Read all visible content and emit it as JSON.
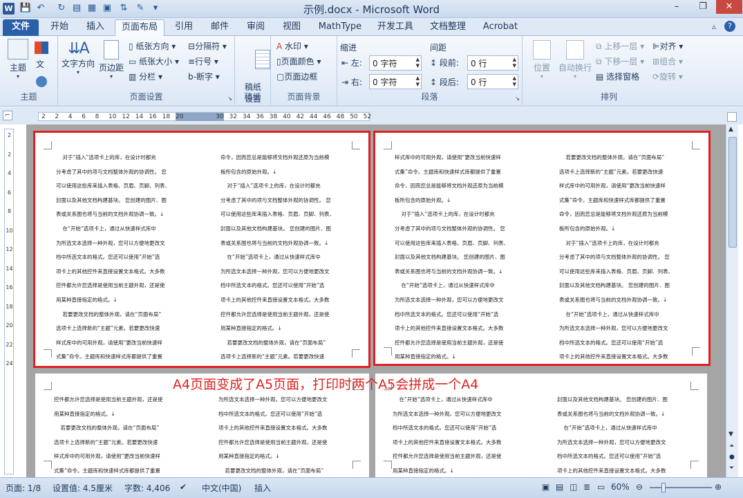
{
  "window": {
    "title": "示例.docx - Microsoft Word",
    "minimize": "–",
    "restore": "❐",
    "close": "✕"
  },
  "tabs": [
    "文件",
    "开始",
    "插入",
    "页面布局",
    "引用",
    "邮件",
    "审阅",
    "视图",
    "MathType",
    "开发工具",
    "文档整理",
    "Acrobat"
  ],
  "ribbon": {
    "theme": {
      "btn": "主题",
      "label": "主题"
    },
    "page_setup": {
      "text_dir": "文字方向",
      "margins": "页边距",
      "paper_dir": "纸张方向",
      "paper_size": "纸张大小",
      "columns": "分栏",
      "breaks": "分隔符",
      "line_num": "行号",
      "hyphen": "断字",
      "label": "页面设置"
    },
    "draft": {
      "btn": "稿纸\n设置",
      "label": "稿纸"
    },
    "background": {
      "watermark": "水印",
      "page_color": "页面颜色",
      "page_border": "页面边框",
      "label": "页面背景"
    },
    "paragraph": {
      "indent": "缩进",
      "left": "左:",
      "left_val": "0 字符",
      "right": "右:",
      "right_val": "0 字符",
      "spacing": "间距",
      "before": "段前:",
      "before_val": "0 行",
      "after": "段后:",
      "after_val": "0 行",
      "label": "段落"
    },
    "arrange": {
      "position": "位置",
      "wrap": "自动换行",
      "forward": "上移一层",
      "backward": "下移一层",
      "select": "选择窗格",
      "align": "对齐",
      "group": "组合",
      "rotate": "旋转",
      "label": "排列"
    }
  },
  "ruler": {
    "h": [
      "2",
      "2",
      "4",
      "6",
      "8",
      "10",
      "12",
      "14",
      "16",
      "18",
      "20",
      "",
      "",
      "30",
      "32",
      "34",
      "36",
      "38",
      "40",
      "42",
      "44",
      "46",
      "48",
      "50",
      "52"
    ],
    "v": [
      "2",
      "2",
      "4",
      "6",
      "8",
      "10",
      "12",
      "14",
      "16",
      "18",
      "20",
      "22",
      "24"
    ]
  },
  "caption": "A4页面变成了A5页面，打印时两个A5会拼成一个A4",
  "pages": {
    "p1_left": [
      "    对于“插入”选项卡上的库，在设计时都充",
      "分考虑了其中的项与文档整体外观的协调性。 您",
      "可以使用这些库来插入表格、页眉、页脚、列表、",
      "封面以及其他文档构建基块。 您创建的图片、图",
      "表或关系图也将与当前的文档外观协调一致。↓",
      "    在“开始”选项卡上，通过从快速样式库中",
      "为所选文本选择一种外观，您可以方便地更改文",
      "档中所选文本的格式。您还可以使用“开始”选",
      "项卡上的其他控件来直接设置文本格式。大多数",
      "控件都允许您选择是使用当前主题外观，还是使",
      "用某种直接指定的格式。↓",
      "    若要更改文档的整体外观，请在“页面布局”",
      "选项卡上选择新的“主题”元素。若要更改快速",
      "样式库中的可用外观，请使用“更改当前快速样",
      "式集”命令。主题库和快速样式库都提供了重置"
    ],
    "p1_right": [
      "命令，因而您总是能够将文档外观还原为当前模",
      "板所包含的原始外观。↓",
      "    对于“插入”选项卡上的库，在设计时都充",
      "分考虑了其中的项与文档整体外观的协调性。 您",
      "可以使用这些库来插入表格、页眉、页脚、列表、",
      "封面以及其他文档构建基块。 您创建的图片、图",
      "表或关系图也将与当前的文档外观协调一致。↓",
      "    在“开始”选项卡上，通过从快速样式库中",
      "为所选文本选择一种外观，您可以方便地更改文",
      "档中所选文本的格式。您还可以使用“开始”选",
      "项卡上的其他控件来直接设置文本格式。大多数",
      "控件都允许您选择是使用当前主题外观，还是使",
      "用某种直接指定的格式。↓",
      "    若要更改文档的整体外观，请在“页面布局”",
      "选项卡上选择新的“主题”元素。若要更改快速"
    ],
    "p2_left": [
      "样式库中的可用外观，请使用“更改当前快速样",
      "式集”命令。主题库和快速样式库都提供了重置",
      "命令，因而您总是能够将文档外观还原为当前模",
      "板所包含的原始外观。↓",
      "    对于“插入”选项卡上的库，在设计时都充",
      "分考虑了其中的项与文档整体外观的协调性。 您",
      "可以使用这些库来插入表格、页眉、页脚、列表、",
      "封面以及其他文档构建基块。 您创建的图片、图",
      "表或关系图也将与当前的文档外观协调一致。↓",
      "    在“开始”选项卡上，通过从快速样式库中",
      "为所选文本选择一种外观，您可以方便地更改文",
      "档中所选文本的格式。您还可以使用“开始”选",
      "项卡上的其他控件来直接设置文本格式。大多数",
      "控件都允许您选择是使用当前主题外观，还是使",
      "用某种直接指定的格式。↓"
    ],
    "p2_right": [
      "    若要更改文档的整体外观，请在“页面布局”",
      "选项卡上选择新的“主题”元素。若要更改快速",
      "样式库中的可用外观，请使用“更改当前快速样",
      "式集”命令。主题库和快速样式库都提供了重置",
      "命令，因而您总是能够将文档外观还原为当前模",
      "板所包含的原始外观。↓",
      "    对于“插入”选项卡上的库，在设计时都充",
      "分考虑了其中的项与文档整体外观的协调性。 您",
      "可以使用这些库来插入表格、页眉、页脚、列表、",
      "封面以及其他文档构建基块。 您创建的图片、图",
      "表或关系图也将与当前的文档外观协调一致。↓",
      "    在“开始”选项卡上，通过从快速样式库中",
      "为所选文本选择一种外观，您可以方便地更改文",
      "档中所选文本的格式。您还可以使用“开始”选",
      "项卡上的其他控件来直接设置文本格式。大多数"
    ],
    "p3_left": [
      "控件都允许您选择是使用当前主题外观，还是使",
      "用某种直接指定的格式。↓",
      "    若要更改文档的整体外观，请在“页面布局”",
      "选项卡上选择新的“主题”元素。若要更改快速",
      "样式库中的可用外观，请使用“更改当前快速样",
      "式集”命令。主题库和快速样式库都提供了重置"
    ],
    "p3_right": [
      "为所选文本选择一种外观，您可以方便地更改文",
      "档中所选文本的格式。您还可以使用“开始”选",
      "项卡上的其他控件来直接设置文本格式。大多数",
      "控件都允许您选择是使用当前主题外观，还是使",
      "用某种直接指定的格式。↓",
      "    若要更改文档的整体外观，请在“页面布局”"
    ],
    "p4_left": [
      "    在“开始”选项卡上，通过从快速样式库中",
      "为所选文本选择一种外观，您可以方便地更改文",
      "档中所选文本的格式。您还可以使用“开始”选",
      "项卡上的其他控件来直接设置文本格式。大多数",
      "控件都允许您选择是使用当前主题外观，还是使",
      "用某种直接指定的格式。↓"
    ],
    "p4_right": [
      "封面以及其他文档构建基块。 您创建的图片、图",
      "表或关系图也将与当前的文档外观协调一致。↓",
      "    在“开始”选项卡上，通过从快速样式库中",
      "为所选文本选择一种外观，您可以方便地更改文",
      "档中所选文本的格式。您还可以使用“开始”选",
      "项卡上的其他控件来直接设置文本格式。大多数"
    ]
  },
  "status": {
    "page": "页面: 1/8",
    "setting": "设置值: 4.5厘米",
    "words": "字数: 4,406",
    "lang": "中文(中国)",
    "mode": "插入",
    "zoom": "60%"
  },
  "colors": {
    "accent": "#2a5faa",
    "highlight": "#e02020"
  }
}
